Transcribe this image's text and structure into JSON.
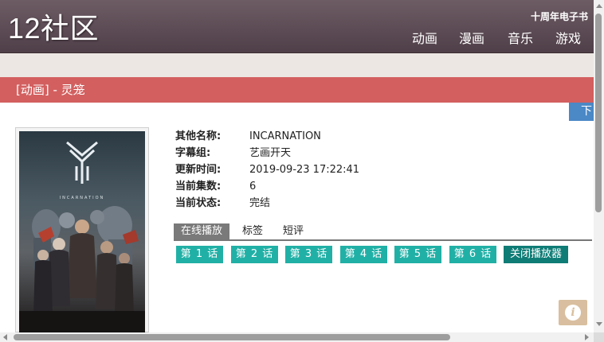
{
  "header": {
    "logo": "12社区",
    "ebook_link": "十周年电子书",
    "nav": [
      {
        "label": "动画"
      },
      {
        "label": "漫画"
      },
      {
        "label": "音乐"
      },
      {
        "label": "游戏"
      }
    ]
  },
  "title_bar": {
    "title": "[动画] - 灵笼"
  },
  "download_tab": {
    "label": "下"
  },
  "poster": {
    "text": "INCARNATION"
  },
  "info": [
    {
      "label": "其他名称:",
      "value": "INCARNATION"
    },
    {
      "label": "字幕组:",
      "value": "艺画开天"
    },
    {
      "label": "更新时间:",
      "value": "2019-09-23 17:22:41"
    },
    {
      "label": "当前集数:",
      "value": "6"
    },
    {
      "label": "当前状态:",
      "value": "完结"
    }
  ],
  "tabs": [
    {
      "label": "在线播放",
      "active": true
    },
    {
      "label": "标签",
      "active": false
    },
    {
      "label": "短评",
      "active": false
    }
  ],
  "episodes": [
    {
      "label": "第 1 话"
    },
    {
      "label": "第 2 话"
    },
    {
      "label": "第 3 话"
    },
    {
      "label": "第 4 话"
    },
    {
      "label": "第 5 话"
    },
    {
      "label": "第 6 话"
    }
  ],
  "close_player_label": "关闭播放器",
  "info_button": {
    "icon": "info-icon",
    "glyph": "i"
  },
  "colors": {
    "header_bg": "#5d4c55",
    "title_bar": "#d35f5f",
    "episode_button": "#21b0a6",
    "close_button": "#0f7c76",
    "download_tab": "#4a88c6",
    "info_button": "#d9bf9f"
  }
}
